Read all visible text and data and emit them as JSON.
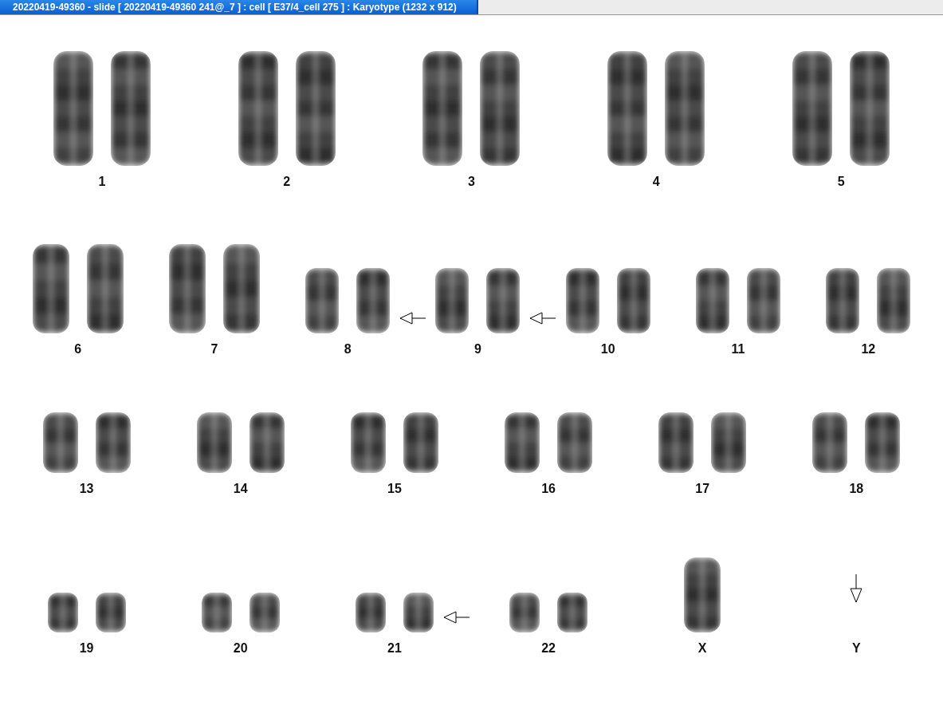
{
  "window": {
    "title": "20220419-49360 - slide [ 20220419-49360 241@_7 ] : cell [ E37/4_cell 275 ] : Karyotype  (1232 x 912)"
  },
  "rows": [
    {
      "groups": [
        {
          "label": "1",
          "kind": "plain",
          "chromosomes": [
            {
              "kind": "autosome"
            },
            {
              "kind": "autosome"
            }
          ]
        },
        {
          "label": "2",
          "kind": "plain",
          "chromosomes": [
            {
              "kind": "autosome"
            },
            {
              "kind": "autosome"
            }
          ]
        },
        {
          "label": "3",
          "kind": "plain",
          "chromosomes": [
            {
              "kind": "autosome"
            },
            {
              "kind": "autosome"
            }
          ]
        },
        {
          "label": "4",
          "kind": "plain",
          "chromosomes": [
            {
              "kind": "autosome"
            },
            {
              "kind": "autosome"
            }
          ]
        },
        {
          "label": "5",
          "kind": "plain",
          "chromosomes": [
            {
              "kind": "autosome"
            },
            {
              "kind": "autosome"
            }
          ]
        }
      ]
    },
    {
      "groups": [
        {
          "label": "6",
          "kind": "plain",
          "chromosomes": [
            {
              "kind": "autosome"
            },
            {
              "kind": "autosome"
            }
          ]
        },
        {
          "label": "7",
          "kind": "plain",
          "chromosomes": [
            {
              "kind": "autosome"
            },
            {
              "kind": "autosome"
            }
          ]
        },
        {
          "label": "8",
          "kind": "flagged",
          "chromosomes": [
            {
              "kind": "autosome"
            },
            {
              "kind": "autosome"
            }
          ]
        },
        {
          "label": "9",
          "kind": "flagged",
          "chromosomes": [
            {
              "kind": "autosome"
            },
            {
              "kind": "autosome"
            }
          ]
        },
        {
          "label": "10",
          "kind": "plain",
          "chromosomes": [
            {
              "kind": "autosome"
            },
            {
              "kind": "autosome"
            }
          ]
        },
        {
          "label": "11",
          "kind": "plain",
          "chromosomes": [
            {
              "kind": "autosome"
            },
            {
              "kind": "autosome"
            }
          ]
        },
        {
          "label": "12",
          "kind": "plain",
          "chromosomes": [
            {
              "kind": "autosome"
            },
            {
              "kind": "autosome"
            }
          ]
        }
      ]
    },
    {
      "groups": [
        {
          "label": "13",
          "kind": "plain",
          "chromosomes": [
            {
              "kind": "autosome"
            },
            {
              "kind": "autosome"
            }
          ]
        },
        {
          "label": "14",
          "kind": "plain",
          "chromosomes": [
            {
              "kind": "autosome"
            },
            {
              "kind": "autosome"
            }
          ]
        },
        {
          "label": "15",
          "kind": "plain",
          "chromosomes": [
            {
              "kind": "autosome"
            },
            {
              "kind": "autosome"
            }
          ]
        },
        {
          "label": "16",
          "kind": "plain",
          "chromosomes": [
            {
              "kind": "autosome"
            },
            {
              "kind": "autosome"
            }
          ]
        },
        {
          "label": "17",
          "kind": "plain",
          "chromosomes": [
            {
              "kind": "autosome"
            },
            {
              "kind": "autosome"
            }
          ]
        },
        {
          "label": "18",
          "kind": "plain",
          "chromosomes": [
            {
              "kind": "autosome"
            },
            {
              "kind": "autosome"
            }
          ]
        }
      ]
    },
    {
      "groups": [
        {
          "label": "19",
          "kind": "plain",
          "chromosomes": [
            {
              "kind": "autosome"
            },
            {
              "kind": "autosome"
            }
          ]
        },
        {
          "label": "20",
          "kind": "plain",
          "chromosomes": [
            {
              "kind": "autosome"
            },
            {
              "kind": "autosome"
            }
          ]
        },
        {
          "label": "21",
          "kind": "flagged",
          "chromosomes": [
            {
              "kind": "autosome"
            },
            {
              "kind": "autosome"
            }
          ]
        },
        {
          "label": "22",
          "kind": "plain",
          "chromosomes": [
            {
              "kind": "autosome"
            },
            {
              "kind": "autosome"
            }
          ]
        },
        {
          "label": "X",
          "kind": "plain",
          "chromosomes": [
            {
              "kind": "gonosome"
            }
          ]
        },
        {
          "label": "Y",
          "kind": "missing"
        }
      ]
    }
  ]
}
